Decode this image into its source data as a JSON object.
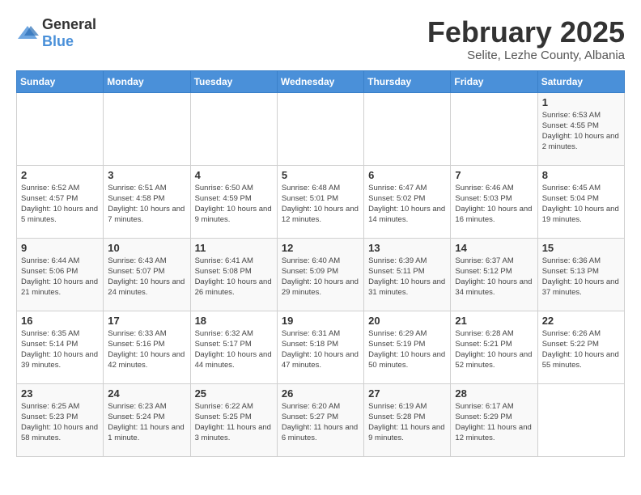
{
  "logo": {
    "general": "General",
    "blue": "Blue"
  },
  "title": "February 2025",
  "subtitle": "Selite, Lezhe County, Albania",
  "days_of_week": [
    "Sunday",
    "Monday",
    "Tuesday",
    "Wednesday",
    "Thursday",
    "Friday",
    "Saturday"
  ],
  "weeks": [
    [
      {
        "day": "",
        "info": ""
      },
      {
        "day": "",
        "info": ""
      },
      {
        "day": "",
        "info": ""
      },
      {
        "day": "",
        "info": ""
      },
      {
        "day": "",
        "info": ""
      },
      {
        "day": "",
        "info": ""
      },
      {
        "day": "1",
        "info": "Sunrise: 6:53 AM\nSunset: 4:55 PM\nDaylight: 10 hours and 2 minutes."
      }
    ],
    [
      {
        "day": "2",
        "info": "Sunrise: 6:52 AM\nSunset: 4:57 PM\nDaylight: 10 hours and 5 minutes."
      },
      {
        "day": "3",
        "info": "Sunrise: 6:51 AM\nSunset: 4:58 PM\nDaylight: 10 hours and 7 minutes."
      },
      {
        "day": "4",
        "info": "Sunrise: 6:50 AM\nSunset: 4:59 PM\nDaylight: 10 hours and 9 minutes."
      },
      {
        "day": "5",
        "info": "Sunrise: 6:48 AM\nSunset: 5:01 PM\nDaylight: 10 hours and 12 minutes."
      },
      {
        "day": "6",
        "info": "Sunrise: 6:47 AM\nSunset: 5:02 PM\nDaylight: 10 hours and 14 minutes."
      },
      {
        "day": "7",
        "info": "Sunrise: 6:46 AM\nSunset: 5:03 PM\nDaylight: 10 hours and 16 minutes."
      },
      {
        "day": "8",
        "info": "Sunrise: 6:45 AM\nSunset: 5:04 PM\nDaylight: 10 hours and 19 minutes."
      }
    ],
    [
      {
        "day": "9",
        "info": "Sunrise: 6:44 AM\nSunset: 5:06 PM\nDaylight: 10 hours and 21 minutes."
      },
      {
        "day": "10",
        "info": "Sunrise: 6:43 AM\nSunset: 5:07 PM\nDaylight: 10 hours and 24 minutes."
      },
      {
        "day": "11",
        "info": "Sunrise: 6:41 AM\nSunset: 5:08 PM\nDaylight: 10 hours and 26 minutes."
      },
      {
        "day": "12",
        "info": "Sunrise: 6:40 AM\nSunset: 5:09 PM\nDaylight: 10 hours and 29 minutes."
      },
      {
        "day": "13",
        "info": "Sunrise: 6:39 AM\nSunset: 5:11 PM\nDaylight: 10 hours and 31 minutes."
      },
      {
        "day": "14",
        "info": "Sunrise: 6:37 AM\nSunset: 5:12 PM\nDaylight: 10 hours and 34 minutes."
      },
      {
        "day": "15",
        "info": "Sunrise: 6:36 AM\nSunset: 5:13 PM\nDaylight: 10 hours and 37 minutes."
      }
    ],
    [
      {
        "day": "16",
        "info": "Sunrise: 6:35 AM\nSunset: 5:14 PM\nDaylight: 10 hours and 39 minutes."
      },
      {
        "day": "17",
        "info": "Sunrise: 6:33 AM\nSunset: 5:16 PM\nDaylight: 10 hours and 42 minutes."
      },
      {
        "day": "18",
        "info": "Sunrise: 6:32 AM\nSunset: 5:17 PM\nDaylight: 10 hours and 44 minutes."
      },
      {
        "day": "19",
        "info": "Sunrise: 6:31 AM\nSunset: 5:18 PM\nDaylight: 10 hours and 47 minutes."
      },
      {
        "day": "20",
        "info": "Sunrise: 6:29 AM\nSunset: 5:19 PM\nDaylight: 10 hours and 50 minutes."
      },
      {
        "day": "21",
        "info": "Sunrise: 6:28 AM\nSunset: 5:21 PM\nDaylight: 10 hours and 52 minutes."
      },
      {
        "day": "22",
        "info": "Sunrise: 6:26 AM\nSunset: 5:22 PM\nDaylight: 10 hours and 55 minutes."
      }
    ],
    [
      {
        "day": "23",
        "info": "Sunrise: 6:25 AM\nSunset: 5:23 PM\nDaylight: 10 hours and 58 minutes."
      },
      {
        "day": "24",
        "info": "Sunrise: 6:23 AM\nSunset: 5:24 PM\nDaylight: 11 hours and 1 minute."
      },
      {
        "day": "25",
        "info": "Sunrise: 6:22 AM\nSunset: 5:25 PM\nDaylight: 11 hours and 3 minutes."
      },
      {
        "day": "26",
        "info": "Sunrise: 6:20 AM\nSunset: 5:27 PM\nDaylight: 11 hours and 6 minutes."
      },
      {
        "day": "27",
        "info": "Sunrise: 6:19 AM\nSunset: 5:28 PM\nDaylight: 11 hours and 9 minutes."
      },
      {
        "day": "28",
        "info": "Sunrise: 6:17 AM\nSunset: 5:29 PM\nDaylight: 11 hours and 12 minutes."
      },
      {
        "day": "",
        "info": ""
      }
    ]
  ]
}
